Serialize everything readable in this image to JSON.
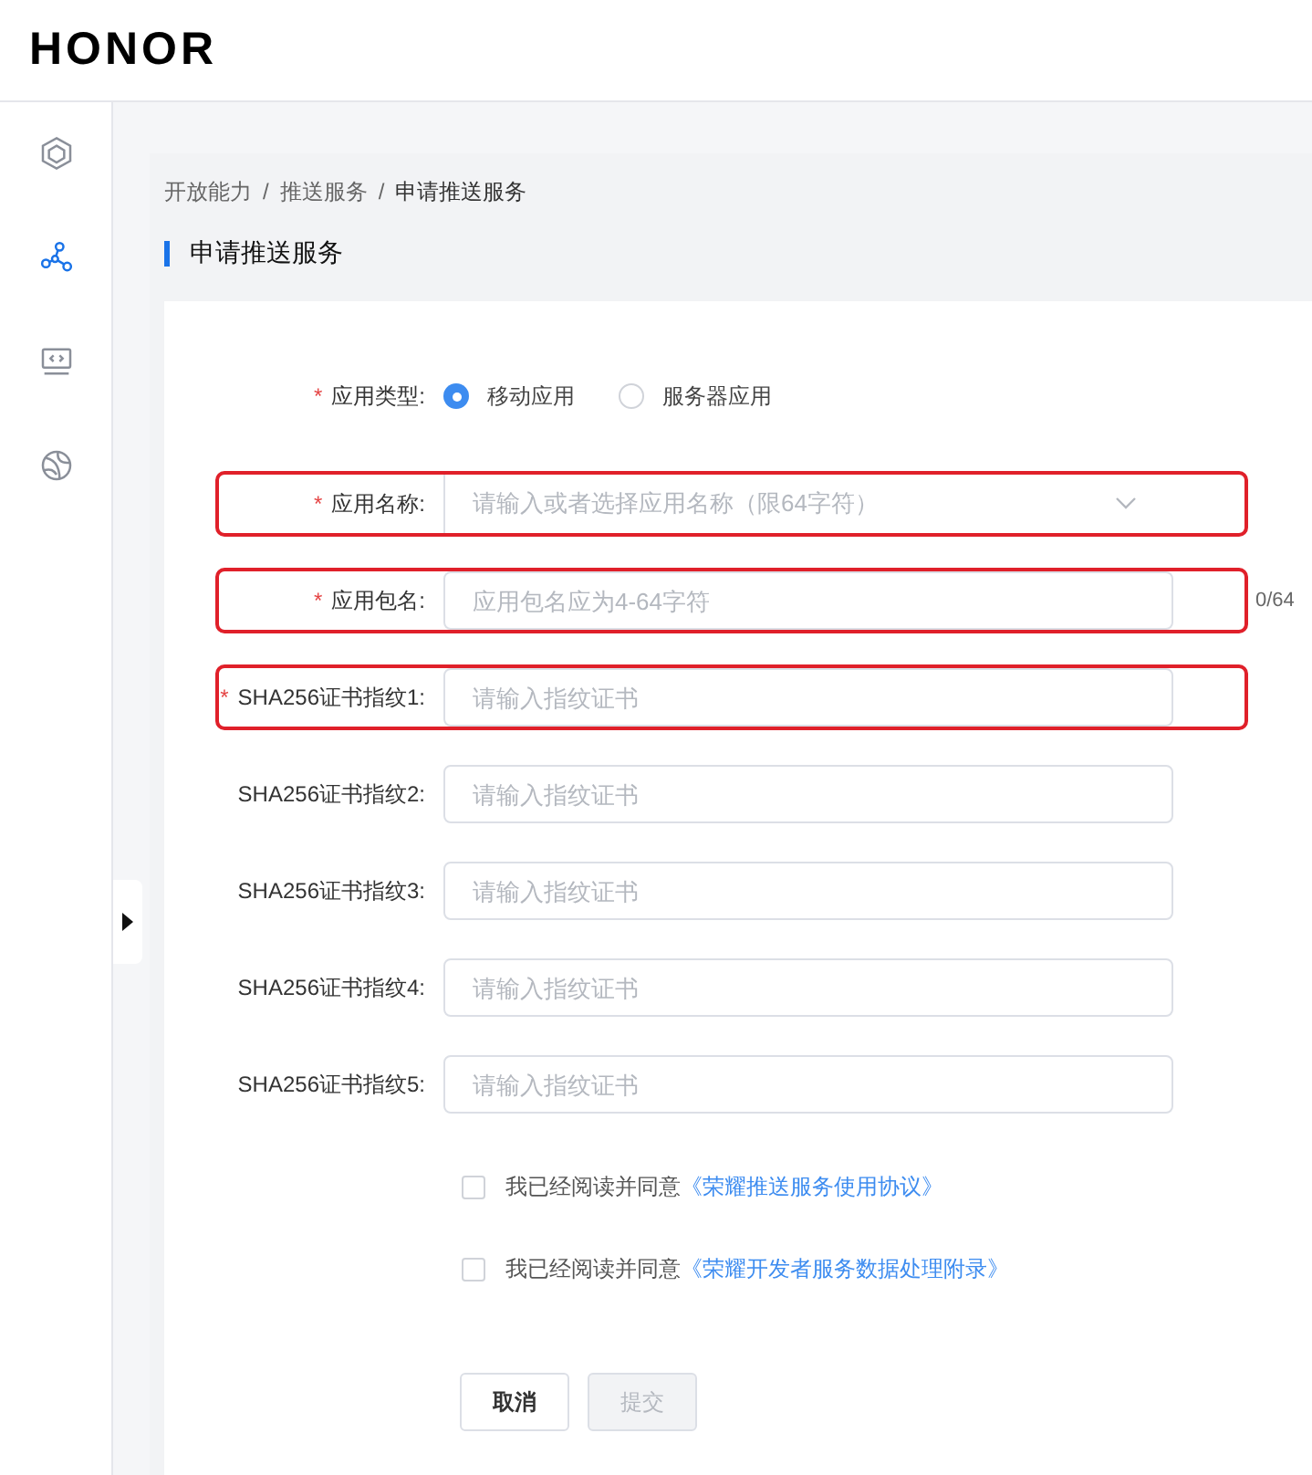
{
  "header": {
    "logo": "HONOR"
  },
  "sidebar": {
    "items": [
      {
        "selected": false
      },
      {
        "selected": true
      },
      {
        "selected": false
      },
      {
        "selected": false
      }
    ]
  },
  "breadcrumb": [
    "开放能力",
    "推送服务",
    "申请推送服务"
  ],
  "breadcrumb_separator": "/",
  "page_title": "申请推送服务",
  "form": {
    "app_type": {
      "label": "应用类型:",
      "marker": "*",
      "options": [
        {
          "label": "移动应用",
          "selected": true
        },
        {
          "label": "服务器应用",
          "selected": false
        }
      ]
    },
    "fields": [
      {
        "kind": "select",
        "label": "应用名称:",
        "marker": "*",
        "placeholder": "请输入或者选择应用名称（限64字符）",
        "highlighted": true
      },
      {
        "kind": "input",
        "label": "应用包名:",
        "marker": "*",
        "placeholder": "应用包名应为4-64字符",
        "counter": "0/64",
        "highlighted": true
      },
      {
        "kind": "input",
        "label": "SHA256证书指纹1:",
        "marker": "*",
        "placeholder": "请输入指纹证书",
        "highlighted": true
      },
      {
        "kind": "input",
        "label": "SHA256证书指纹2:",
        "placeholder": "请输入指纹证书",
        "highlighted": false
      },
      {
        "kind": "input",
        "label": "SHA256证书指纹3:",
        "placeholder": "请输入指纹证书",
        "highlighted": false
      },
      {
        "kind": "input",
        "label": "SHA256证书指纹4:",
        "placeholder": "请输入指纹证书",
        "highlighted": false
      },
      {
        "kind": "input",
        "label": "SHA256证书指纹5:",
        "placeholder": "请输入指纹证书",
        "highlighted": false
      }
    ],
    "agreements": [
      {
        "text": "我已经阅读并同意",
        "link": "《荣耀推送服务使用协议》",
        "checked": false
      },
      {
        "text": "我已经阅读并同意",
        "link": "《荣耀开发者服务数据处理附录》",
        "checked": false
      }
    ],
    "buttons": [
      {
        "label": "取消",
        "disabled": false
      },
      {
        "label": "提交",
        "disabled": true
      }
    ]
  }
}
